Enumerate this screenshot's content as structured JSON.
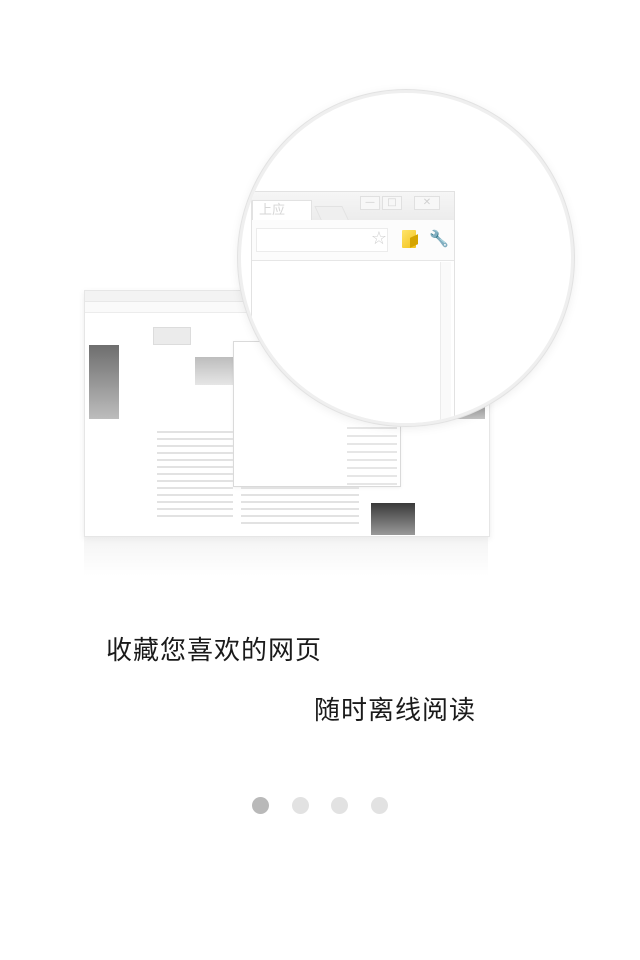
{
  "illustration": {
    "tab_label": "上应",
    "icons": {
      "star": "star-icon",
      "bookmark": "bookmark-folder-icon",
      "wrench": "wrench-icon",
      "minimize": "minimize-icon",
      "maximize": "maximize-icon",
      "close": "close-icon"
    },
    "bookmark_color": "#f2c21a"
  },
  "intro": {
    "line1": "收藏您喜欢的网页",
    "line2": "随时离线阅读"
  },
  "pager": {
    "total": 4,
    "current": 1,
    "active_color": "#b9b9b9",
    "inactive_color": "#e2e2e2"
  }
}
